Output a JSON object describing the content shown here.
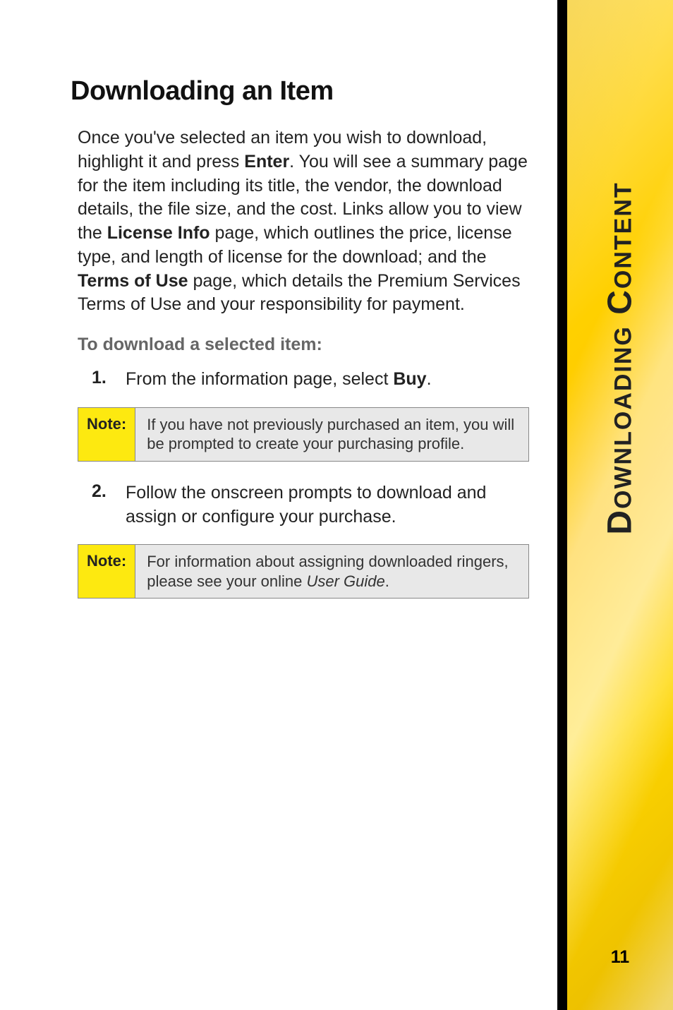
{
  "heading": "Downloading an Item",
  "intro": {
    "part1": "Once you've selected an item you wish to download, highlight it and press ",
    "bold1": "Enter",
    "part2": ". You will see a summary page for the item including its title, the vendor, the download details, the file size, and the cost. Links allow you to view the ",
    "bold2": "License Info",
    "part3": " page, which outlines the price, license type, and length of license for the download; and the ",
    "bold3": "Terms of Use",
    "part4": " page, which details the Premium Services Terms of Use and your responsibility for payment."
  },
  "subhead": "To download a selected item:",
  "step1": {
    "num": "1.",
    "text1": "From the information page, select ",
    "bold": "Buy",
    "text2": "."
  },
  "note1": {
    "label": "Note:",
    "text": "If you have not previously purchased an item, you will be prompted to create your purchasing profile."
  },
  "step2": {
    "num": "2.",
    "text": "Follow the onscreen prompts to download and assign or configure your purchase."
  },
  "note2": {
    "label": "Note:",
    "text1": "For information about assigning downloaded ringers, please see your online ",
    "italic": "User Guide",
    "text2": "."
  },
  "sideTab": "Downloading Content",
  "pageNumber": "11"
}
